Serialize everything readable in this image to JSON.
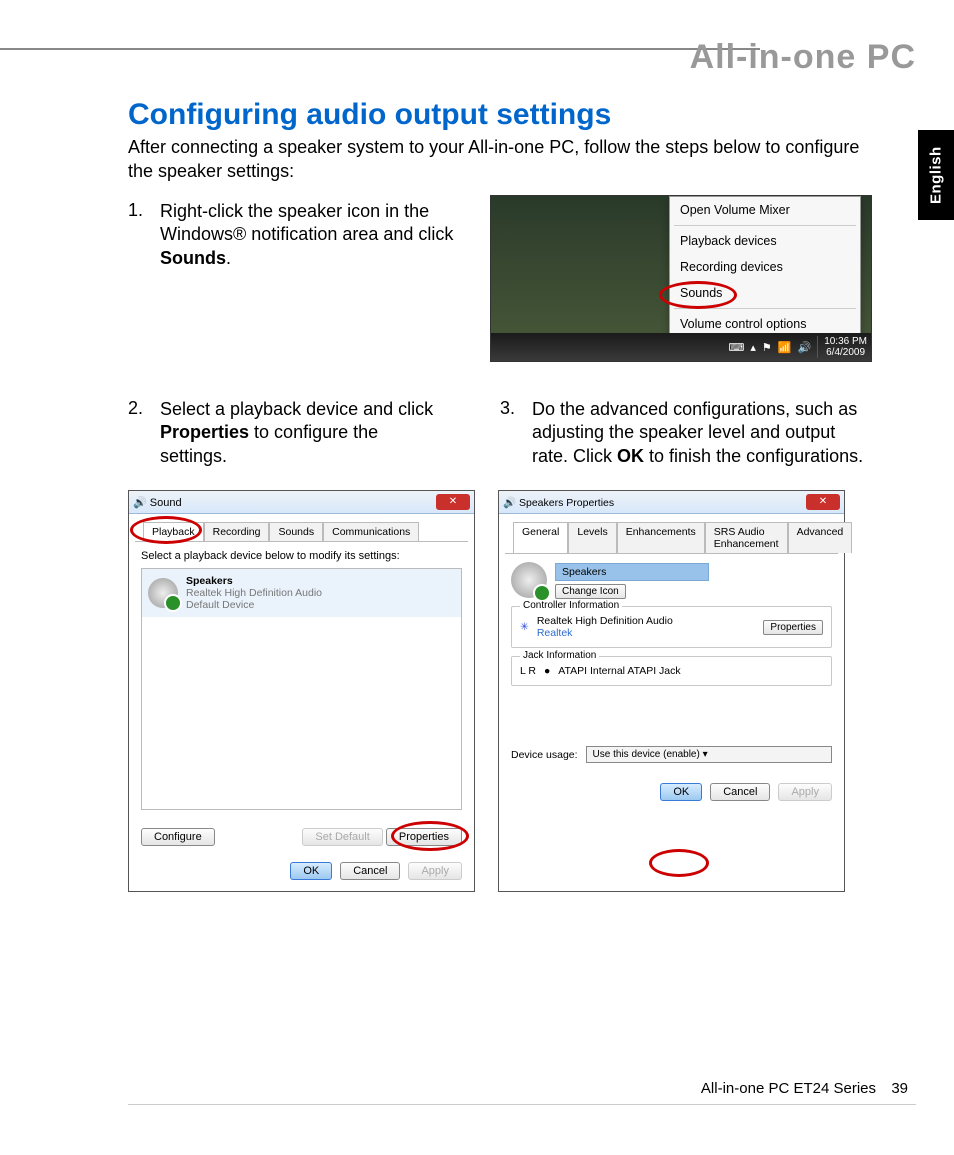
{
  "header": {
    "product_title": "All-in-one PC"
  },
  "language_tab": "English",
  "title": "Configuring audio output settings",
  "intro": "After connecting a speaker system to your All-in-one PC, follow the steps below to configure the speaker settings:",
  "steps": {
    "s1_num": "1.",
    "s1_a": "Right-click the speaker icon in the Windows® notification area and click ",
    "s1_b": "Sounds",
    "s1_c": ".",
    "s2_num": "2.",
    "s2_a": "Select a playback device and click ",
    "s2_b": "Properties",
    "s2_c": " to configure the settings.",
    "s3_num": "3.",
    "s3_a": "Do the advanced configurations, such as adjusting the speaker level and output rate. Click ",
    "s3_b": "OK",
    "s3_c": " to finish the configurations."
  },
  "context_menu": {
    "items": [
      "Open Volume Mixer",
      "Playback devices",
      "Recording devices",
      "Sounds",
      "Volume control options"
    ]
  },
  "taskbar": {
    "time": "10:36 PM",
    "date": "6/4/2009"
  },
  "sound_dialog": {
    "title": "Sound",
    "tabs": [
      "Playback",
      "Recording",
      "Sounds",
      "Communications"
    ],
    "prompt": "Select a playback device below to modify its settings:",
    "device": {
      "name": "Speakers",
      "driver": "Realtek High Definition Audio",
      "status": "Default Device"
    },
    "btn_configure": "Configure",
    "btn_setdefault": "Set Default",
    "btn_properties": "Properties",
    "btn_ok": "OK",
    "btn_cancel": "Cancel",
    "btn_apply": "Apply"
  },
  "speakers_props": {
    "title": "Speakers Properties",
    "tabs": [
      "General",
      "Levels",
      "Enhancements",
      "SRS Audio Enhancement",
      "Advanced"
    ],
    "name_value": "Speakers",
    "change_icon": "Change Icon",
    "ctrl_label": "Controller Information",
    "ctrl_name": "Realtek High Definition Audio",
    "ctrl_vendor": "Realtek",
    "ctrl_properties": "Properties",
    "jack_label": "Jack Information",
    "jack_lr": "L R",
    "jack_text": "ATAPI Internal ATAPI Jack",
    "device_usage_label": "Device usage:",
    "device_usage_value": "Use this device (enable)",
    "btn_ok": "OK",
    "btn_cancel": "Cancel",
    "btn_apply": "Apply"
  },
  "footer": {
    "text": "All-in-one PC ET24 Series",
    "page": "39"
  }
}
